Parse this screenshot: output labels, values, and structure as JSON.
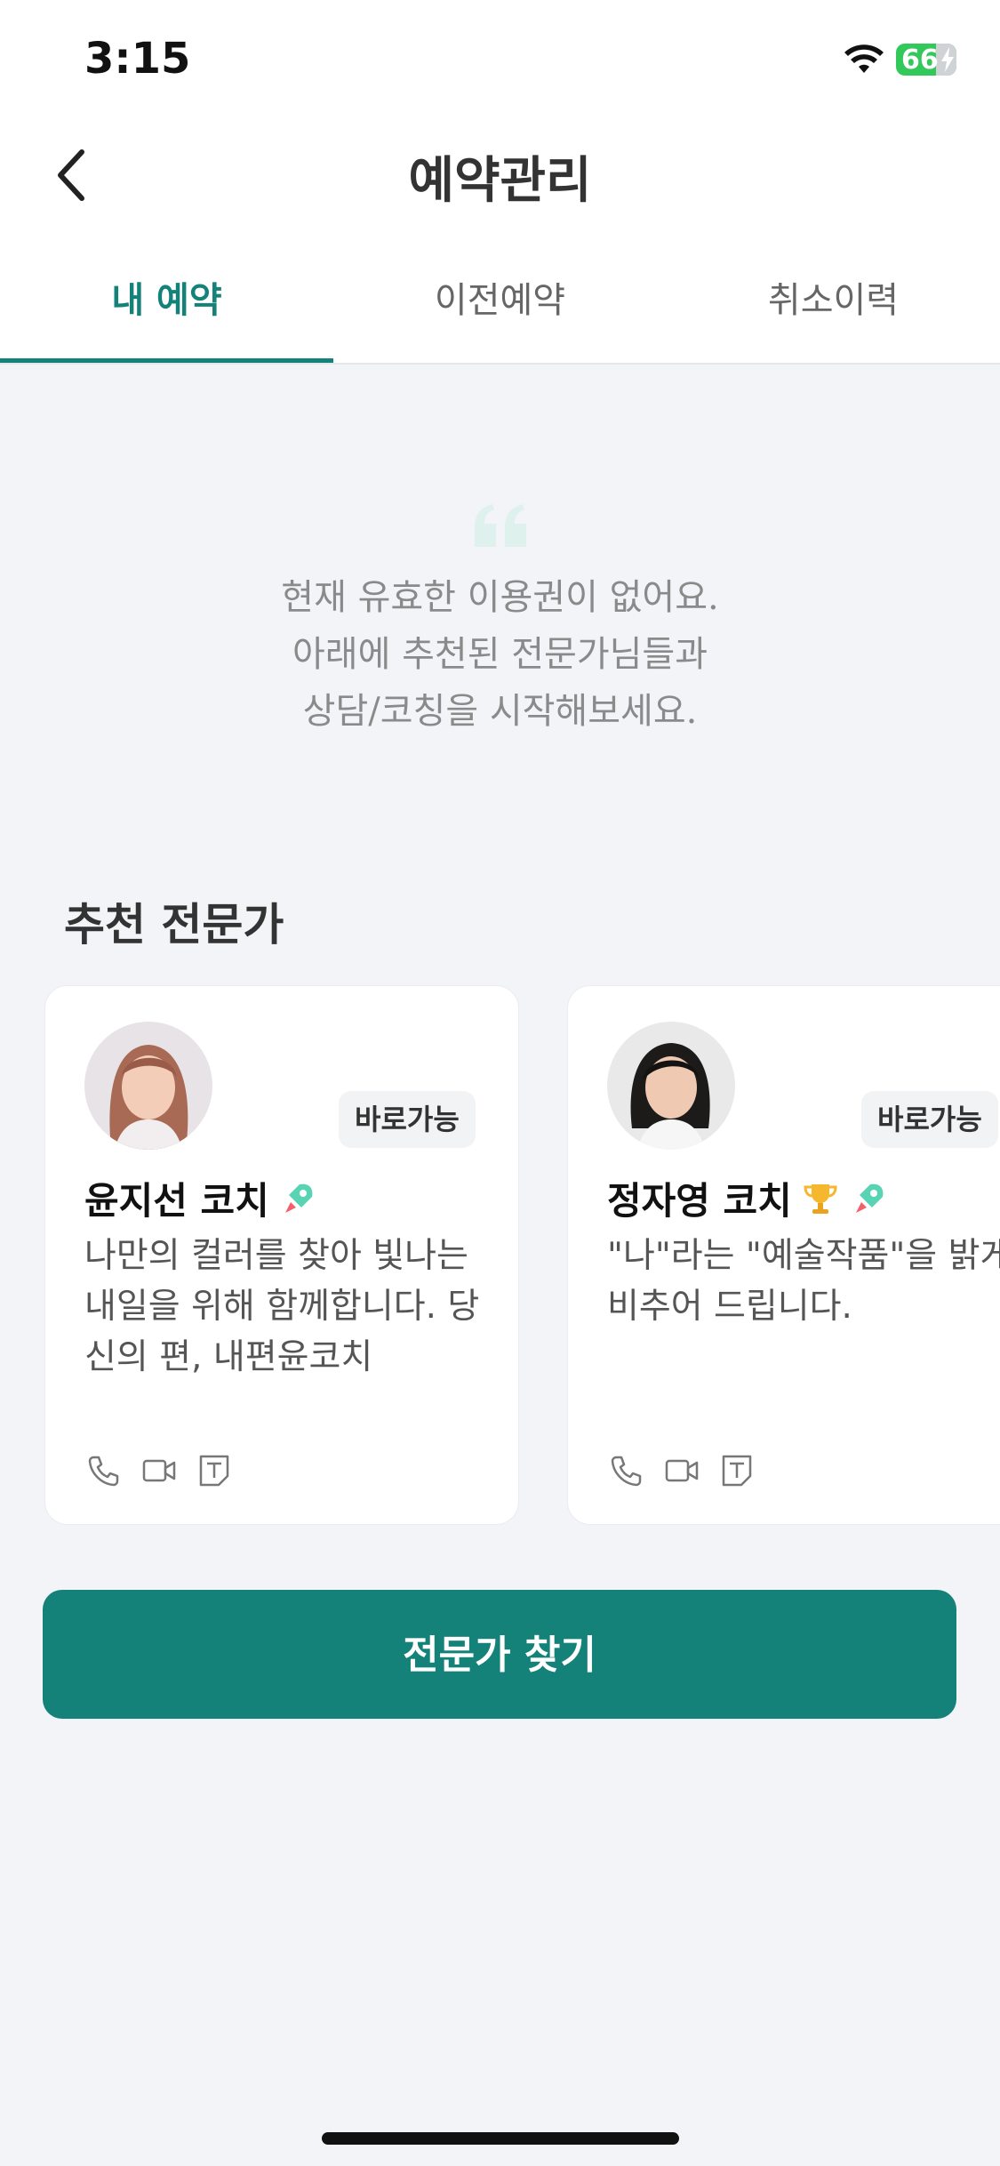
{
  "status_bar": {
    "time": "3:15",
    "battery": "66"
  },
  "header": {
    "title": "예약관리"
  },
  "tabs": [
    {
      "label": "내 예약",
      "active": true
    },
    {
      "label": "이전예약",
      "active": false
    },
    {
      "label": "취소이력",
      "active": false
    }
  ],
  "empty_state": {
    "lines": [
      "현재 유효한 이용권이 없어요.",
      "아래에 추천된 전문가님들과",
      "상담/코칭을 시작해보세요."
    ]
  },
  "recommended": {
    "title": "추천 전문가",
    "experts": [
      {
        "name": "윤지선 코치",
        "badge": "바로가능",
        "icons": [
          "rocket-icon"
        ],
        "description": "나만의 컬러를 찾아 빛나는 내일을 위해 함께합니다. 당신의 편, 내편윤코치"
      },
      {
        "name": "정자영 코치",
        "badge": "바로가능",
        "icons": [
          "trophy-icon",
          "rocket-icon"
        ],
        "description": "\"나\"라는 \"예술작품\"을 밝게 비추어 드립니다."
      }
    ]
  },
  "cta": {
    "label": "전문가 찾기"
  },
  "colors": {
    "accent": "#15827a",
    "background": "#f3f4f8"
  }
}
